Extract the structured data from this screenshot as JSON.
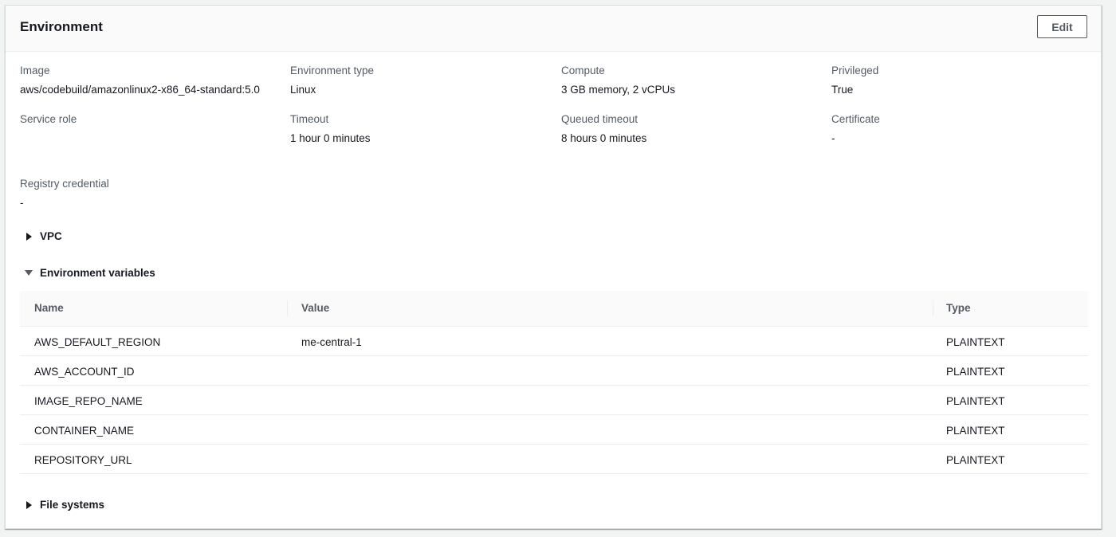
{
  "header": {
    "title": "Environment",
    "edit_label": "Edit"
  },
  "fields": [
    {
      "label": "Image",
      "value": "aws/codebuild/amazonlinux2-x86_64-standard:5.0"
    },
    {
      "label": "Environment type",
      "value": "Linux"
    },
    {
      "label": "Compute",
      "value": "3 GB memory, 2 vCPUs"
    },
    {
      "label": "Privileged",
      "value": "True"
    },
    {
      "label": "Service role",
      "value": ""
    },
    {
      "label": "Timeout",
      "value": "1 hour 0 minutes"
    },
    {
      "label": "Queued timeout",
      "value": "8 hours 0 minutes"
    },
    {
      "label": "Certificate",
      "value": "-"
    },
    {
      "label": "Registry credential",
      "value": "-"
    }
  ],
  "sections": {
    "vpc": {
      "label": "VPC",
      "expanded": false
    },
    "env_vars": {
      "label": "Environment variables",
      "expanded": true
    },
    "file_systems": {
      "label": "File systems",
      "expanded": false
    }
  },
  "env_table": {
    "columns": [
      "Name",
      "Value",
      "Type"
    ],
    "rows": [
      {
        "name": "AWS_DEFAULT_REGION",
        "value": "me-central-1",
        "type": "PLAINTEXT"
      },
      {
        "name": "AWS_ACCOUNT_ID",
        "value": "",
        "type": "PLAINTEXT"
      },
      {
        "name": "IMAGE_REPO_NAME",
        "value": "",
        "type": "PLAINTEXT"
      },
      {
        "name": "CONTAINER_NAME",
        "value": "",
        "type": "PLAINTEXT"
      },
      {
        "name": "REPOSITORY_URL",
        "value": "",
        "type": "PLAINTEXT"
      }
    ]
  },
  "colors": {
    "label": "#545b64",
    "text": "#16191f",
    "border": "#eaeded",
    "header_bg": "#fafafa"
  },
  "icons": {
    "collapsed": "caret-right-icon",
    "expanded": "caret-down-icon"
  }
}
